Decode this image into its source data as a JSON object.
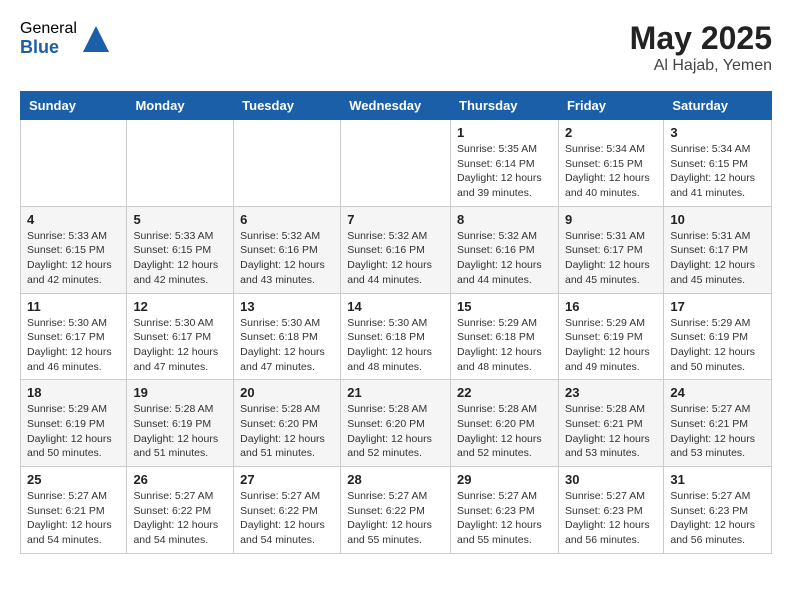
{
  "header": {
    "logo_general": "General",
    "logo_blue": "Blue",
    "month_year": "May 2025",
    "location": "Al Hajab, Yemen"
  },
  "weekdays": [
    "Sunday",
    "Monday",
    "Tuesday",
    "Wednesday",
    "Thursday",
    "Friday",
    "Saturday"
  ],
  "weeks": [
    [
      {
        "day": "",
        "info": ""
      },
      {
        "day": "",
        "info": ""
      },
      {
        "day": "",
        "info": ""
      },
      {
        "day": "",
        "info": ""
      },
      {
        "day": "1",
        "info": "Sunrise: 5:35 AM\nSunset: 6:14 PM\nDaylight: 12 hours\nand 39 minutes."
      },
      {
        "day": "2",
        "info": "Sunrise: 5:34 AM\nSunset: 6:15 PM\nDaylight: 12 hours\nand 40 minutes."
      },
      {
        "day": "3",
        "info": "Sunrise: 5:34 AM\nSunset: 6:15 PM\nDaylight: 12 hours\nand 41 minutes."
      }
    ],
    [
      {
        "day": "4",
        "info": "Sunrise: 5:33 AM\nSunset: 6:15 PM\nDaylight: 12 hours\nand 42 minutes."
      },
      {
        "day": "5",
        "info": "Sunrise: 5:33 AM\nSunset: 6:15 PM\nDaylight: 12 hours\nand 42 minutes."
      },
      {
        "day": "6",
        "info": "Sunrise: 5:32 AM\nSunset: 6:16 PM\nDaylight: 12 hours\nand 43 minutes."
      },
      {
        "day": "7",
        "info": "Sunrise: 5:32 AM\nSunset: 6:16 PM\nDaylight: 12 hours\nand 44 minutes."
      },
      {
        "day": "8",
        "info": "Sunrise: 5:32 AM\nSunset: 6:16 PM\nDaylight: 12 hours\nand 44 minutes."
      },
      {
        "day": "9",
        "info": "Sunrise: 5:31 AM\nSunset: 6:17 PM\nDaylight: 12 hours\nand 45 minutes."
      },
      {
        "day": "10",
        "info": "Sunrise: 5:31 AM\nSunset: 6:17 PM\nDaylight: 12 hours\nand 45 minutes."
      }
    ],
    [
      {
        "day": "11",
        "info": "Sunrise: 5:30 AM\nSunset: 6:17 PM\nDaylight: 12 hours\nand 46 minutes."
      },
      {
        "day": "12",
        "info": "Sunrise: 5:30 AM\nSunset: 6:17 PM\nDaylight: 12 hours\nand 47 minutes."
      },
      {
        "day": "13",
        "info": "Sunrise: 5:30 AM\nSunset: 6:18 PM\nDaylight: 12 hours\nand 47 minutes."
      },
      {
        "day": "14",
        "info": "Sunrise: 5:30 AM\nSunset: 6:18 PM\nDaylight: 12 hours\nand 48 minutes."
      },
      {
        "day": "15",
        "info": "Sunrise: 5:29 AM\nSunset: 6:18 PM\nDaylight: 12 hours\nand 48 minutes."
      },
      {
        "day": "16",
        "info": "Sunrise: 5:29 AM\nSunset: 6:19 PM\nDaylight: 12 hours\nand 49 minutes."
      },
      {
        "day": "17",
        "info": "Sunrise: 5:29 AM\nSunset: 6:19 PM\nDaylight: 12 hours\nand 50 minutes."
      }
    ],
    [
      {
        "day": "18",
        "info": "Sunrise: 5:29 AM\nSunset: 6:19 PM\nDaylight: 12 hours\nand 50 minutes."
      },
      {
        "day": "19",
        "info": "Sunrise: 5:28 AM\nSunset: 6:19 PM\nDaylight: 12 hours\nand 51 minutes."
      },
      {
        "day": "20",
        "info": "Sunrise: 5:28 AM\nSunset: 6:20 PM\nDaylight: 12 hours\nand 51 minutes."
      },
      {
        "day": "21",
        "info": "Sunrise: 5:28 AM\nSunset: 6:20 PM\nDaylight: 12 hours\nand 52 minutes."
      },
      {
        "day": "22",
        "info": "Sunrise: 5:28 AM\nSunset: 6:20 PM\nDaylight: 12 hours\nand 52 minutes."
      },
      {
        "day": "23",
        "info": "Sunrise: 5:28 AM\nSunset: 6:21 PM\nDaylight: 12 hours\nand 53 minutes."
      },
      {
        "day": "24",
        "info": "Sunrise: 5:27 AM\nSunset: 6:21 PM\nDaylight: 12 hours\nand 53 minutes."
      }
    ],
    [
      {
        "day": "25",
        "info": "Sunrise: 5:27 AM\nSunset: 6:21 PM\nDaylight: 12 hours\nand 54 minutes."
      },
      {
        "day": "26",
        "info": "Sunrise: 5:27 AM\nSunset: 6:22 PM\nDaylight: 12 hours\nand 54 minutes."
      },
      {
        "day": "27",
        "info": "Sunrise: 5:27 AM\nSunset: 6:22 PM\nDaylight: 12 hours\nand 54 minutes."
      },
      {
        "day": "28",
        "info": "Sunrise: 5:27 AM\nSunset: 6:22 PM\nDaylight: 12 hours\nand 55 minutes."
      },
      {
        "day": "29",
        "info": "Sunrise: 5:27 AM\nSunset: 6:23 PM\nDaylight: 12 hours\nand 55 minutes."
      },
      {
        "day": "30",
        "info": "Sunrise: 5:27 AM\nSunset: 6:23 PM\nDaylight: 12 hours\nand 56 minutes."
      },
      {
        "day": "31",
        "info": "Sunrise: 5:27 AM\nSunset: 6:23 PM\nDaylight: 12 hours\nand 56 minutes."
      }
    ]
  ]
}
